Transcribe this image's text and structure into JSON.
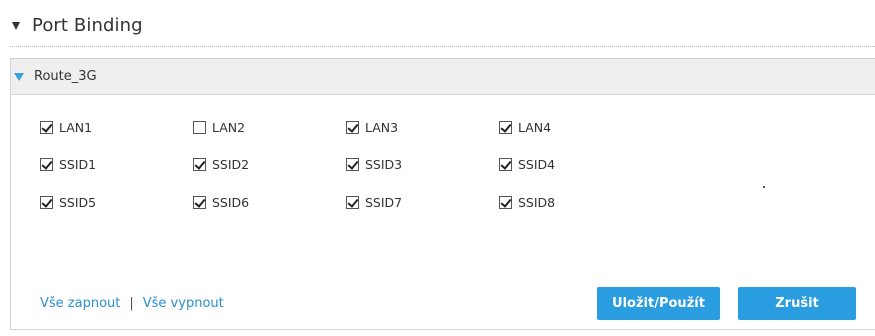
{
  "section": {
    "title": "Port Binding"
  },
  "panel": {
    "title": "Route_3G"
  },
  "ports": [
    {
      "label": "LAN1",
      "checked": true
    },
    {
      "label": "LAN2",
      "checked": false
    },
    {
      "label": "LAN3",
      "checked": true
    },
    {
      "label": "LAN4",
      "checked": true
    },
    {
      "label": "SSID1",
      "checked": true
    },
    {
      "label": "SSID2",
      "checked": true
    },
    {
      "label": "SSID3",
      "checked": true
    },
    {
      "label": "SSID4",
      "checked": true
    },
    {
      "label": "SSID5",
      "checked": true
    },
    {
      "label": "SSID6",
      "checked": true
    },
    {
      "label": "SSID7",
      "checked": true
    },
    {
      "label": "SSID8",
      "checked": true
    }
  ],
  "links": {
    "select_all": "Vše zapnout",
    "separator": "|",
    "deselect_all": "Vše vypnout"
  },
  "buttons": {
    "save": "Uložit/Použít",
    "cancel": "Zrušit"
  },
  "colors": {
    "accent": "#2a9de0",
    "link": "#2a8fce",
    "header_bg": "#efefef"
  }
}
